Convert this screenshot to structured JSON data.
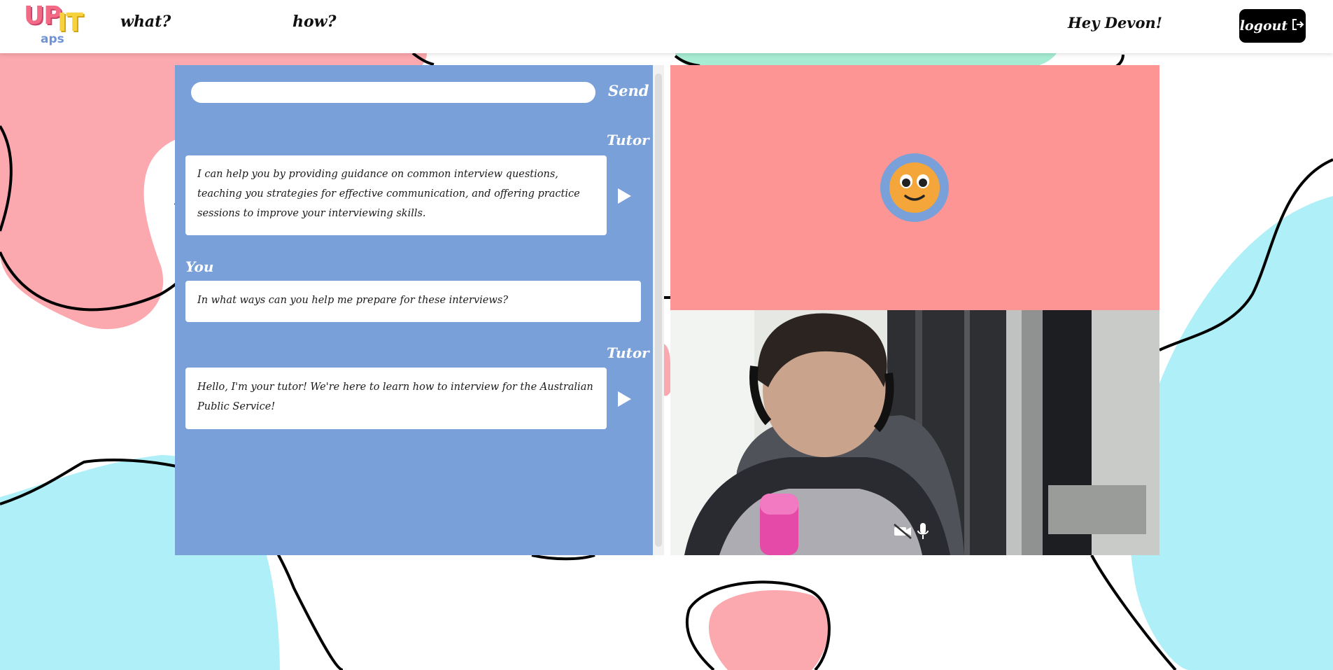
{
  "header": {
    "logo": {
      "up": "UP",
      "it": "IT",
      "aps": "aps"
    },
    "nav": [
      {
        "label": "what?"
      },
      {
        "label": "how?"
      }
    ],
    "greeting": "Hey Devon!",
    "logout_label": "logout"
  },
  "chat": {
    "input_value": "",
    "input_placeholder": "",
    "send_label": "Send",
    "messages": [
      {
        "sender": "Tutor",
        "text": "I can help you by providing guidance on common interview questions, teaching you strategies for effective communication, and offering practice sessions to improve your interviewing skills."
      },
      {
        "sender": "You",
        "text": "In what ways can you help me prepare for these interviews?"
      },
      {
        "sender": "Tutor",
        "text": "Hello, I'm your tutor! We're here to learn how to interview for the Australian Public Service!"
      }
    ]
  },
  "tutor_avatar": {
    "icon": "smiley-face-icon"
  },
  "video": {
    "controls": [
      "camera-off-icon",
      "microphone-icon"
    ]
  },
  "colors": {
    "chat_panel": "#79a0d9",
    "tutor_panel": "#fd9595",
    "blob_pink": "#fba8ae",
    "blob_cyan": "#aeeff8",
    "blob_mint": "#a6ecd2",
    "logout_bg": "#000000"
  }
}
